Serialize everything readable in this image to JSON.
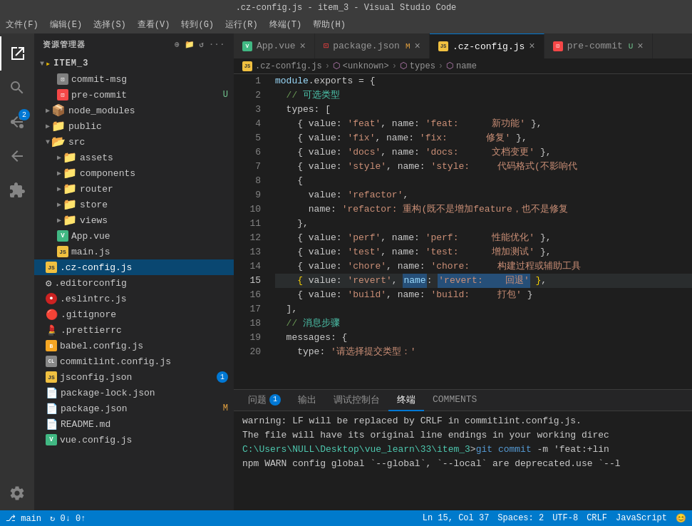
{
  "titleBar": {
    "text": ".cz-config.js - item_3 - Visual Studio Code"
  },
  "menuBar": {
    "items": [
      "文件(F)",
      "编辑(E)",
      "选择(S)",
      "查看(V)",
      "转到(G)",
      "运行(R)",
      "终端(T)",
      "帮助(H)"
    ]
  },
  "sidebar": {
    "title": "资源管理器",
    "rootFolder": "ITEM_3",
    "moreIcon": "···",
    "files": [
      {
        "id": "commit-msg",
        "indent": 2,
        "icon": "📄",
        "iconColor": "#cccccc",
        "label": "commit-msg",
        "badge": null,
        "type": "file"
      },
      {
        "id": "pre-commit",
        "indent": 2,
        "icon": "🟥",
        "iconColor": "#f44747",
        "label": "pre-commit",
        "badge": "U",
        "badgeType": "u",
        "type": "file"
      },
      {
        "id": "node_modules",
        "indent": 1,
        "icon": "📁",
        "iconColor": "#e8834d",
        "label": "node_modules",
        "badge": null,
        "type": "folder",
        "collapsed": true
      },
      {
        "id": "public",
        "indent": 1,
        "icon": "📁",
        "iconColor": "#e8834d",
        "label": "public",
        "badge": null,
        "type": "folder",
        "collapsed": true
      },
      {
        "id": "src",
        "indent": 1,
        "icon": "📂",
        "iconColor": "#e8834d",
        "label": "src",
        "badge": null,
        "type": "folder",
        "collapsed": false
      },
      {
        "id": "assets",
        "indent": 2,
        "icon": "📁",
        "iconColor": "#e8834d",
        "label": "assets",
        "badge": null,
        "type": "folder",
        "collapsed": true
      },
      {
        "id": "components",
        "indent": 2,
        "icon": "📁",
        "iconColor": "#e8834d",
        "label": "components",
        "badge": null,
        "type": "folder",
        "collapsed": true
      },
      {
        "id": "router",
        "indent": 2,
        "icon": "📁",
        "iconColor": "#e8834d",
        "label": "router",
        "badge": null,
        "type": "folder",
        "collapsed": true
      },
      {
        "id": "store",
        "indent": 2,
        "icon": "📁",
        "iconColor": "#e8834d",
        "label": "store",
        "badge": null,
        "type": "folder",
        "collapsed": true
      },
      {
        "id": "views",
        "indent": 2,
        "icon": "📁",
        "iconColor": "#e8834d",
        "label": "views",
        "badge": null,
        "type": "folder",
        "collapsed": true
      },
      {
        "id": "App.vue",
        "indent": 2,
        "icon": "V",
        "iconColor": "#41b883",
        "label": "App.vue",
        "badge": null,
        "type": "file"
      },
      {
        "id": "main.js",
        "indent": 2,
        "icon": "JS",
        "iconColor": "#f0e040",
        "label": "main.js",
        "badge": null,
        "type": "file"
      },
      {
        "id": ".cz-config.js",
        "indent": 1,
        "icon": "JS",
        "iconColor": "#f0e040",
        "label": ".cz-config.js",
        "badge": null,
        "type": "file",
        "active": true
      },
      {
        "id": ".editorconfig",
        "indent": 1,
        "icon": "⚙",
        "iconColor": "#cccccc",
        "label": ".editorconfig",
        "badge": null,
        "type": "file"
      },
      {
        "id": ".eslintrc.js",
        "indent": 1,
        "icon": "🔴",
        "iconColor": "#f44747",
        "label": ".eslintrc.js",
        "badge": null,
        "type": "file"
      },
      {
        "id": ".gitignore",
        "indent": 1,
        "icon": "🔴",
        "iconColor": "#cccccc",
        "label": ".gitignore",
        "badge": null,
        "type": "file"
      },
      {
        "id": ".prettierrc",
        "indent": 1,
        "icon": "💄",
        "iconColor": "#f8a0a0",
        "label": ".prettierrc",
        "badge": null,
        "type": "file"
      },
      {
        "id": "babel.config.js",
        "indent": 1,
        "icon": "B",
        "iconColor": "#f5a623",
        "label": "babel.config.js",
        "badge": null,
        "type": "file"
      },
      {
        "id": "commitlint.config.js",
        "indent": 1,
        "icon": "CL",
        "iconColor": "#cccccc",
        "label": "commitlint.config.js",
        "badge": null,
        "type": "file"
      },
      {
        "id": "jsconfig.json",
        "indent": 1,
        "icon": "JS",
        "iconColor": "#f0e040",
        "label": "jsconfig.json",
        "badge": "1",
        "badgeType": "number",
        "type": "file"
      },
      {
        "id": "package-lock.json",
        "indent": 1,
        "icon": "📄",
        "iconColor": "#cccccc",
        "label": "package-lock.json",
        "badge": null,
        "type": "file"
      },
      {
        "id": "package.json",
        "indent": 1,
        "icon": "📄",
        "iconColor": "#cccccc",
        "label": "package.json",
        "badge": "M",
        "badgeType": "modified",
        "type": "file"
      },
      {
        "id": "README.md",
        "indent": 1,
        "icon": "📄",
        "iconColor": "#cccccc",
        "label": "README.md",
        "badge": null,
        "type": "file"
      },
      {
        "id": "vue.config.js",
        "indent": 1,
        "icon": "V",
        "iconColor": "#41b883",
        "label": "vue.config.js",
        "badge": null,
        "type": "file"
      }
    ]
  },
  "tabs": [
    {
      "id": "App.vue",
      "label": "App.vue",
      "icon": "V",
      "iconColor": "#41b883",
      "active": false,
      "modified": false
    },
    {
      "id": "package.json",
      "label": "package.json",
      "icon": "📄",
      "iconColor": "#cccccc",
      "active": false,
      "modified": true,
      "modifiedLabel": "M"
    },
    {
      "id": ".cz-config.js",
      "label": ".cz-config.js",
      "icon": "JS",
      "iconColor": "#f0e040",
      "active": true,
      "modified": false
    },
    {
      "id": "pre-commit",
      "label": "pre-commit",
      "icon": "🟥",
      "iconColor": "#f44747",
      "active": false,
      "modified": false,
      "uLabel": "U"
    }
  ],
  "breadcrumb": {
    "items": [
      "JS .cz-config.js",
      "⬡ <unknown>",
      "⬡ types",
      "⬡ name"
    ]
  },
  "codeLines": [
    {
      "num": 1,
      "tokens": [
        {
          "t": "keyword",
          "v": "module"
        },
        {
          "t": "punctuation",
          "v": ".exports = {"
        }
      ]
    },
    {
      "num": 2,
      "tokens": [
        {
          "t": "comment",
          "v": "  // 可选类型"
        }
      ]
    },
    {
      "num": 3,
      "tokens": [
        {
          "t": "text",
          "v": "  types: ["
        }
      ]
    },
    {
      "num": 4,
      "tokens": [
        {
          "t": "text",
          "v": "    { value: "
        },
        {
          "t": "string",
          "v": "'feat'"
        },
        {
          "t": "text",
          "v": ", name: "
        },
        {
          "t": "string",
          "v": "'feat:      新功能'"
        },
        {
          "t": "text",
          "v": " },"
        }
      ]
    },
    {
      "num": 5,
      "tokens": [
        {
          "t": "text",
          "v": "    { value: "
        },
        {
          "t": "string",
          "v": "'fix'"
        },
        {
          "t": "text",
          "v": ", name: "
        },
        {
          "t": "string",
          "v": "'fix:       修复'"
        },
        {
          "t": "text",
          "v": " },"
        }
      ]
    },
    {
      "num": 6,
      "tokens": [
        {
          "t": "text",
          "v": "    { value: "
        },
        {
          "t": "string",
          "v": "'docs'"
        },
        {
          "t": "text",
          "v": ", name: "
        },
        {
          "t": "string",
          "v": "'docs:      文档变更'"
        },
        {
          "t": "text",
          "v": " },"
        }
      ]
    },
    {
      "num": 7,
      "tokens": [
        {
          "t": "text",
          "v": "    { value: "
        },
        {
          "t": "string",
          "v": "'style'"
        },
        {
          "t": "text",
          "v": ", name: "
        },
        {
          "t": "string",
          "v": "'style:     代码格式(不影响代"
        }
      ]
    },
    {
      "num": 8,
      "tokens": [
        {
          "t": "text",
          "v": "    {"
        }
      ]
    },
    {
      "num": 9,
      "tokens": [
        {
          "t": "text",
          "v": "      value: "
        },
        {
          "t": "string",
          "v": "'refactor'"
        },
        {
          "t": "text",
          "v": ","
        }
      ]
    },
    {
      "num": 10,
      "tokens": [
        {
          "t": "text",
          "v": "      name: "
        },
        {
          "t": "string",
          "v": "'refactor: 重构(既不是增加feature，也不是修复"
        }
      ]
    },
    {
      "num": 11,
      "tokens": [
        {
          "t": "text",
          "v": "    },"
        }
      ]
    },
    {
      "num": 12,
      "tokens": [
        {
          "t": "text",
          "v": "    { value: "
        },
        {
          "t": "string",
          "v": "'perf'"
        },
        {
          "t": "text",
          "v": ", name: "
        },
        {
          "t": "string",
          "v": "'perf:      性能优化'"
        },
        {
          "t": "text",
          "v": " },"
        }
      ]
    },
    {
      "num": 13,
      "tokens": [
        {
          "t": "text",
          "v": "    { value: "
        },
        {
          "t": "string",
          "v": "'test'"
        },
        {
          "t": "text",
          "v": ", name: "
        },
        {
          "t": "string",
          "v": "'test:      增加测试'"
        },
        {
          "t": "text",
          "v": " },"
        }
      ]
    },
    {
      "num": 14,
      "tokens": [
        {
          "t": "text",
          "v": "    { value: "
        },
        {
          "t": "string",
          "v": "'chore'"
        },
        {
          "t": "text",
          "v": ", name: "
        },
        {
          "t": "string",
          "v": "'chore:     构建过程或辅助工具"
        }
      ]
    },
    {
      "num": 15,
      "tokens": [
        {
          "t": "highlight",
          "v": "    { value: "
        },
        {
          "t": "string",
          "v": "'revert'"
        },
        {
          "t": "highlight2",
          "v": ", name: "
        },
        {
          "t": "revert-hl",
          "v": "'revert:    回退'"
        },
        {
          "t": "text",
          "v": " },"
        }
      ]
    },
    {
      "num": 16,
      "tokens": [
        {
          "t": "text",
          "v": "    { value: "
        },
        {
          "t": "string",
          "v": "'build'"
        },
        {
          "t": "text",
          "v": ", name: "
        },
        {
          "t": "string",
          "v": "'build:     打包'"
        },
        {
          "t": "text",
          "v": " }"
        }
      ]
    },
    {
      "num": 17,
      "tokens": [
        {
          "t": "text",
          "v": "  ],"
        }
      ]
    },
    {
      "num": 18,
      "tokens": [
        {
          "t": "comment",
          "v": "  // 消息步骤"
        }
      ]
    },
    {
      "num": 19,
      "tokens": [
        {
          "t": "text",
          "v": "  messages: {"
        }
      ]
    },
    {
      "num": 20,
      "tokens": [
        {
          "t": "text",
          "v": "    type: "
        },
        {
          "t": "string",
          "v": "'请选择提交类型：'"
        }
      ]
    }
  ],
  "terminalPanel": {
    "tabs": [
      {
        "id": "problems",
        "label": "问题",
        "badge": "1",
        "active": false
      },
      {
        "id": "output",
        "label": "输出",
        "active": false
      },
      {
        "id": "debug",
        "label": "调试控制台",
        "active": false
      },
      {
        "id": "terminal",
        "label": "终端",
        "active": true
      },
      {
        "id": "comments",
        "label": "COMMENTS",
        "active": false
      }
    ],
    "lines": [
      {
        "text": "warning: LF will be replaced by CRLF in commitlint.config.js.",
        "type": "normal"
      },
      {
        "text": "The file will have its original line endings in your working direc",
        "type": "normal"
      },
      {
        "text": "",
        "type": "normal"
      },
      {
        "text": "C:\\Users\\NULL\\Desktop\\vue_learn\\33\\item_3>git commit -m 'feat:+lin",
        "type": "path"
      },
      {
        "text": "npm WARN config global `--global`, `--local` are deprecated.use `--l",
        "type": "normal"
      }
    ]
  },
  "statusBar": {
    "left": [
      {
        "id": "branch",
        "text": "⎇ main"
      }
    ],
    "right": [
      {
        "id": "encoding",
        "text": "UTF-8"
      },
      {
        "id": "lineEnding",
        "text": "CRLF"
      },
      {
        "id": "language",
        "text": "JavaScript"
      },
      {
        "id": "position",
        "text": "Ln 15, Col 37"
      }
    ]
  }
}
